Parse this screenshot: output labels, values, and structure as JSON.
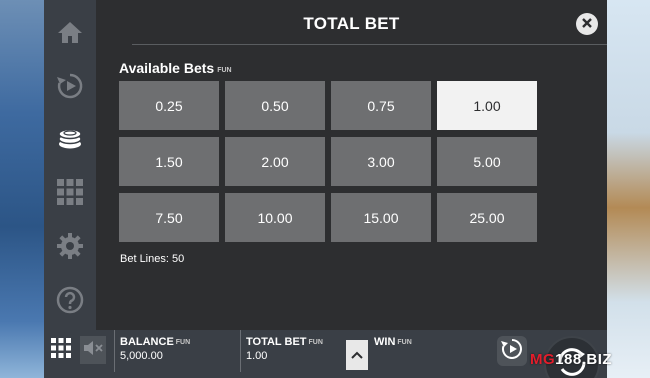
{
  "header": {
    "title": "TOTAL BET"
  },
  "bets": {
    "section_label": "Available Bets",
    "section_tag": "FUN",
    "options": [
      "0.25",
      "0.50",
      "0.75",
      "1.00",
      "1.50",
      "2.00",
      "3.00",
      "5.00",
      "7.50",
      "10.00",
      "15.00",
      "25.00"
    ],
    "selected": "1.00",
    "bet_lines": "Bet Lines: 50"
  },
  "sidenav": {
    "items": [
      "home-icon",
      "autoplay-icon",
      "coin-stack-icon",
      "paytable-grid-icon",
      "gear-icon",
      "help-icon"
    ],
    "active": "coin-stack-icon"
  },
  "bottombar": {
    "balance_label": "BALANCE",
    "balance_tag": "FUN",
    "balance_value": "5,000.00",
    "totalbet_label": "TOTAL BET",
    "totalbet_tag": "FUN",
    "totalbet_value": "1.00",
    "win_label": "WIN",
    "win_tag": "FUN"
  },
  "watermark": {
    "prefix": "MG",
    "suffix": "188.BIZ"
  },
  "colors": {
    "panel": "#2d2e30",
    "tile": "#6e6f71",
    "tile_selected": "#f2f2f2",
    "nav": "#3a3f46",
    "brand_red": "#e21d2b"
  }
}
